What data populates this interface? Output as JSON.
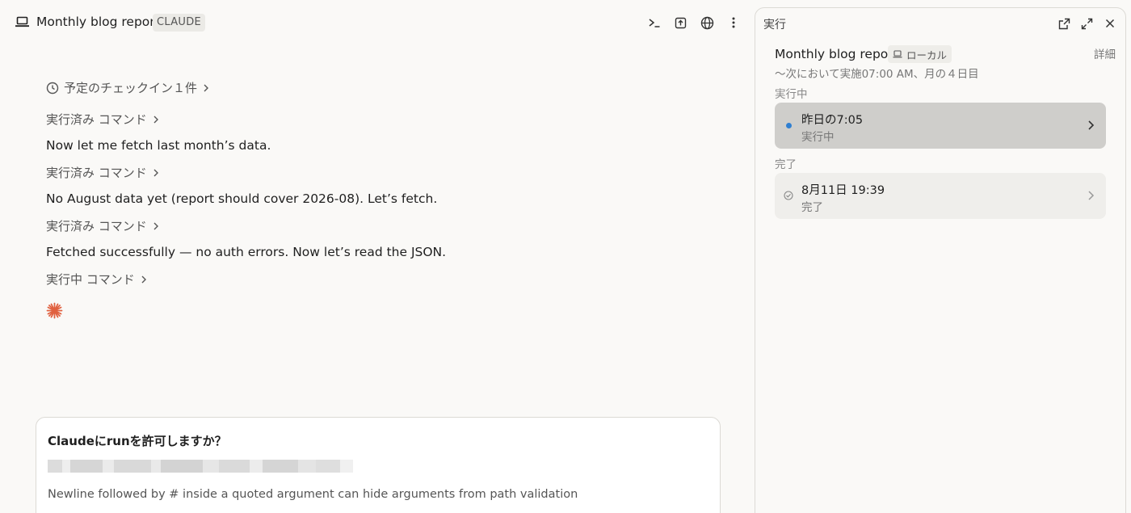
{
  "header": {
    "title": "Monthly blog report",
    "badge": "CLAUDE",
    "icons": [
      "laptop-icon",
      "terminal-icon",
      "upload-box-icon",
      "globe-icon",
      "more-vertical-icon"
    ]
  },
  "chat": {
    "checkin": "予定のチェックイン１件",
    "items": [
      {
        "type": "command",
        "label": "実行済み コマンド"
      },
      {
        "type": "message",
        "text": "Now let me fetch last month’s data."
      },
      {
        "type": "command",
        "label": "実行済み コマンド"
      },
      {
        "type": "message",
        "text": "No August data yet (report should cover 2026-08). Let’s fetch."
      },
      {
        "type": "command",
        "label": "実行済み コマンド"
      },
      {
        "type": "message",
        "text": "Fetched successfully — no auth errors. Now let’s read the JSON."
      },
      {
        "type": "command",
        "label": "実行中 コマンド"
      }
    ],
    "spinner_icon": "sparkle-spinner-icon"
  },
  "permission": {
    "question": "Claudeにrunを許可しますか？",
    "warning": "Newline followed by # inside a quoted argument can hide arguments from path validation"
  },
  "panel": {
    "title": "実行",
    "routine_name": "Monthly blog report",
    "local_badge": "ローカル",
    "detail_link": "詳細",
    "schedule": "〜次において実施07:00 AM、月の４日目",
    "running_section": "実行中",
    "running_run": {
      "time": "昨日の7:05",
      "status": "実行中"
    },
    "done_section": "完了",
    "done_run": {
      "time": "8月11日 19:39",
      "status": "完了"
    }
  },
  "colors": {
    "background": "#faf9f7",
    "accent_running": "#2f7fd1",
    "spinner": "#e0603f"
  }
}
